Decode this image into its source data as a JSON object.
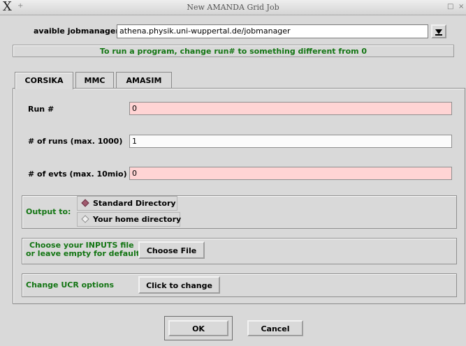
{
  "window": {
    "title": "New AMANDA Grid Job",
    "logo": "X",
    "pin_glyph": "+",
    "minimize_glyph": "□",
    "close_glyph": "×"
  },
  "jobmanager": {
    "label": "avaible jobmanager",
    "value": "athena.physik.uni-wuppertal.de/jobmanager"
  },
  "hint": "To run a program, change run# to something different from 0",
  "tabs": [
    {
      "label": "CORSIKA",
      "active": true
    },
    {
      "label": "MMC",
      "active": false
    },
    {
      "label": "AMASIM",
      "active": false
    }
  ],
  "form": {
    "run_label": "Run #",
    "run_value": "0",
    "runs_label": "# of runs (max. 1000)",
    "runs_value": "1",
    "evts_label": "# of evts (max. 10mio)",
    "evts_value": "0"
  },
  "output": {
    "label": "Output to:",
    "options": [
      {
        "label": "Standard Directory",
        "selected": true
      },
      {
        "label": "Your home directory",
        "selected": false
      }
    ]
  },
  "inputs_file": {
    "label_line1": "Choose your INPUTS file",
    "label_line2": "or leave empty for default",
    "button": "Choose File"
  },
  "ucr": {
    "label": "Change UCR options",
    "button": "Click to change"
  },
  "footer": {
    "ok": "OK",
    "cancel": "Cancel"
  },
  "colors": {
    "accent_green": "#137513",
    "invalid_field": "#ffd4d4",
    "selected_radio": "#a05a6e"
  }
}
